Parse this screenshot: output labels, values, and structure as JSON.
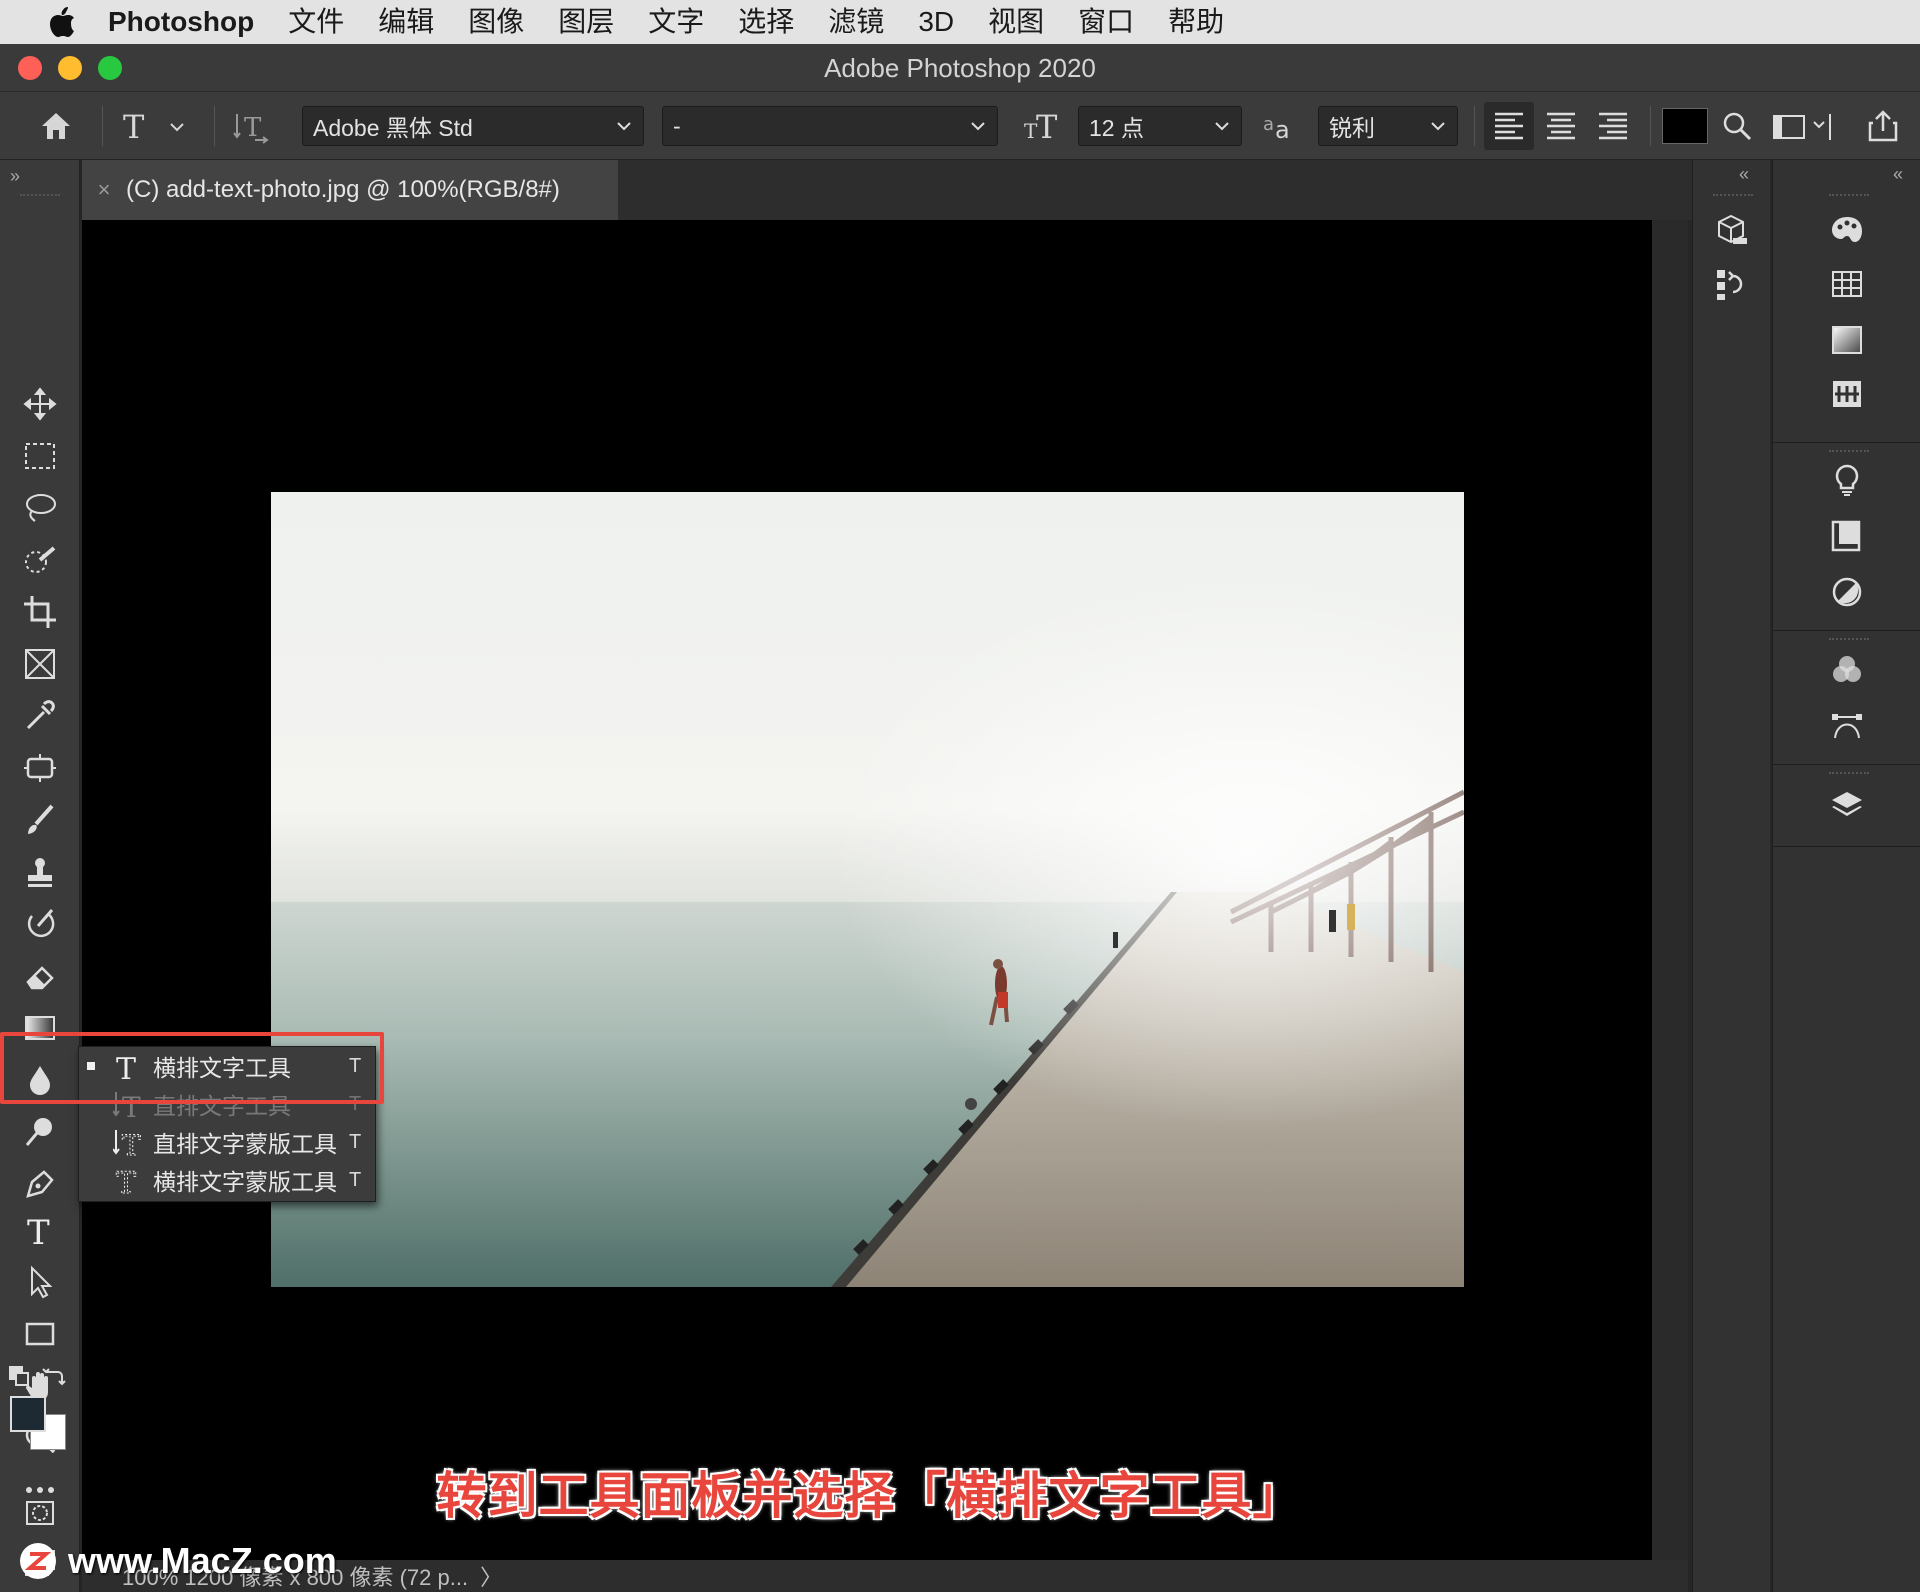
{
  "menubar": {
    "app_name": "Photoshop",
    "items": [
      "文件",
      "编辑",
      "图像",
      "图层",
      "文字",
      "选择",
      "滤镜",
      "3D",
      "视图",
      "窗口",
      "帮助"
    ]
  },
  "window": {
    "title": "Adobe Photoshop 2020"
  },
  "options_bar": {
    "font_family": "Adobe 黑体 Std",
    "font_style": "-",
    "font_size": "12 点",
    "antialias": "锐利"
  },
  "document_tab": {
    "close_glyph": "×",
    "label": "(C) add-text-photo.jpg @ 100%(RGB/8#)"
  },
  "tool_flyout": {
    "items": [
      {
        "label": "横排文字工具",
        "shortcut": "T",
        "selected": true
      },
      {
        "label": "直排文字工具",
        "shortcut": "T",
        "selected": false
      },
      {
        "label": "直排文字蒙版工具",
        "shortcut": "T",
        "selected": false
      },
      {
        "label": "横排文字蒙版工具",
        "shortcut": "T",
        "selected": false
      }
    ]
  },
  "status_bar": {
    "text": "100%     1200 像素 x 800 像素 (72 p...",
    "arrow": "〉"
  },
  "caption": "转到工具面板并选择「横排文字工具」",
  "watermark": "www.MacZ.com",
  "colors": {
    "accent_red": "#e8453c",
    "foreground_swatch": "#1e2a33",
    "background_swatch": "#ffffff",
    "text_color_swatch": "#000000"
  }
}
